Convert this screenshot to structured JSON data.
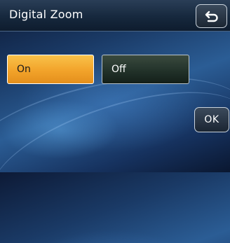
{
  "screen": {
    "title": "Digital Zoom",
    "back_icon": "return-arrow-icon"
  },
  "options": [
    {
      "label": "On",
      "selected": true,
      "color": "#f2a32a"
    },
    {
      "label": "Off",
      "selected": false
    }
  ],
  "actions": {
    "ok_label": "OK"
  }
}
